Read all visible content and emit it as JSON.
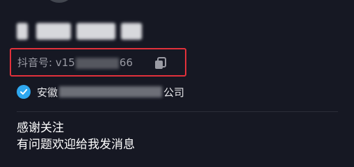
{
  "profile": {
    "nickname": "",
    "id_label_prefix": "抖音号: v15",
    "id_label_suffix": "66",
    "verification_prefix": "安徽",
    "verification_suffix": "公司",
    "bio_lines": [
      "感谢关注",
      "有问题欢迎给我发消息"
    ]
  },
  "icons": {
    "copy": "copy-icon",
    "verified": "verified-check-icon"
  },
  "colors": {
    "background": "#161823",
    "highlight_border": "#e2313b",
    "verified_blue": "#2fa8f0"
  }
}
